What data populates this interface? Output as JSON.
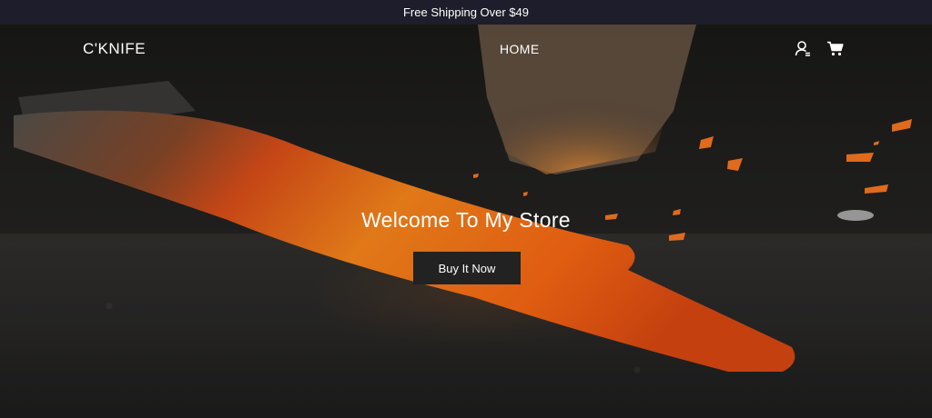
{
  "announcement": {
    "text": "Free Shipping Over $49"
  },
  "header": {
    "logo": "C'KNIFE",
    "nav": [
      {
        "label": "HOME"
      }
    ],
    "icons": [
      "account-icon",
      "cart-icon"
    ]
  },
  "hero": {
    "title": "Welcome To My Store",
    "button_label": "Buy It Now"
  },
  "colors": {
    "announcement_bg": "#1d1d2b",
    "button_bg": "#222222",
    "text": "#ffffff",
    "glow": "#ff7a1a"
  }
}
